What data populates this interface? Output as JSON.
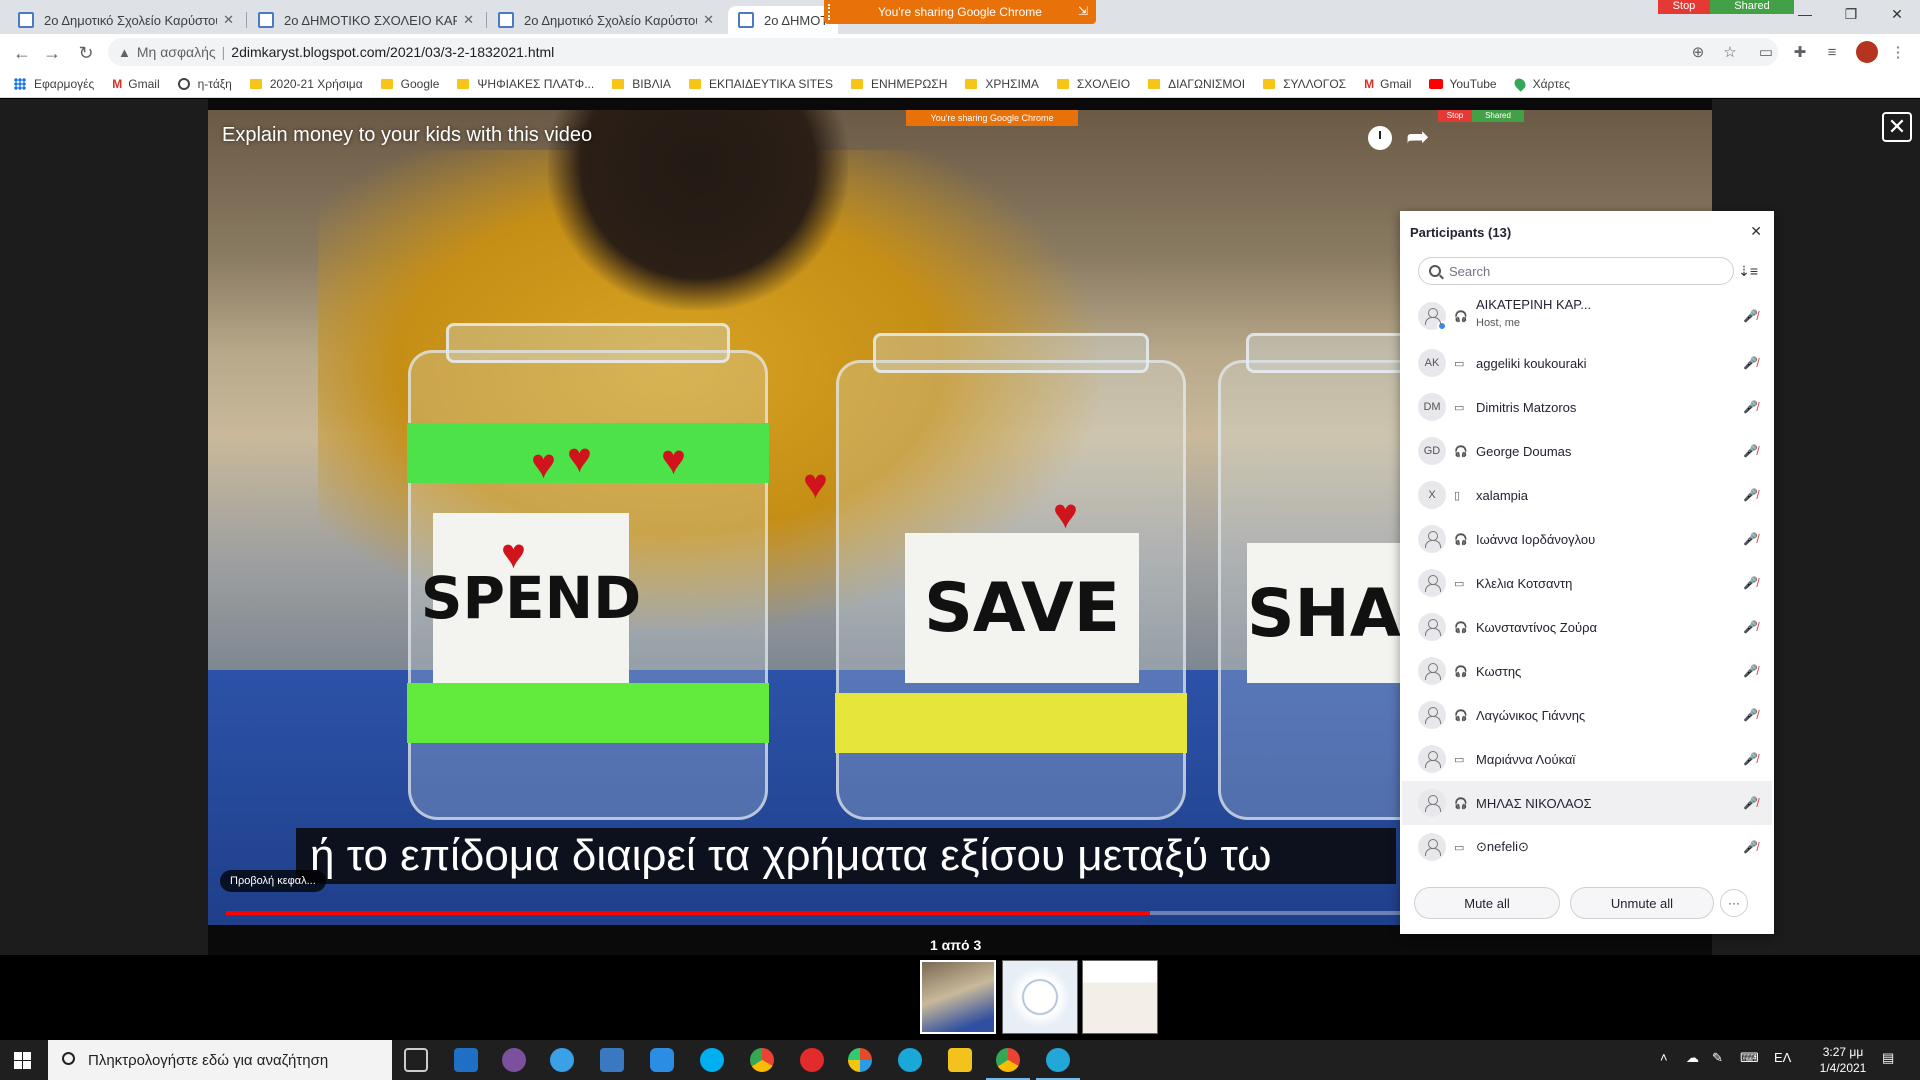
{
  "browser": {
    "tabs": [
      {
        "title": "2ο Δημοτικό Σχολείο Καρύστου"
      },
      {
        "title": "2ο ΔΗΜΟΤΙΚΟ ΣΧΟΛΕΙΟ ΚΑΡΥΣΤ"
      },
      {
        "title": "2ο Δημοτικό Σχολείο Καρύστου"
      },
      {
        "title": "2ο ΔΗΜΟΤΙ"
      }
    ],
    "sharing_banner": "You're sharing Google Chrome",
    "stop_label": "Stop",
    "shared_label": "Shared",
    "security_label": "Μη ασφαλής",
    "url": "2dimkaryst.blogspot.com/2021/03/3-2-1832021.html",
    "bookmarks": [
      {
        "label": "Εφαρμογές",
        "icon": "apps-grid-icon"
      },
      {
        "label": "Gmail",
        "icon": "gmail-icon"
      },
      {
        "label": "η-τάξη",
        "icon": "globe-icon"
      },
      {
        "label": "2020-21 Χρήσιμα",
        "icon": "folder-icon"
      },
      {
        "label": "Google",
        "icon": "folder-icon"
      },
      {
        "label": "ΨΗΦΙΑΚΕΣ ΠΛΑΤΦ...",
        "icon": "folder-icon"
      },
      {
        "label": "ΒΙΒΛΙΑ",
        "icon": "folder-icon"
      },
      {
        "label": "ΕΚΠΑΙΔΕΥΤΙΚΑ SITES",
        "icon": "folder-icon"
      },
      {
        "label": "ΕΝΗΜΕΡΩΣΗ",
        "icon": "folder-icon"
      },
      {
        "label": "ΧΡΗΣΙΜΑ",
        "icon": "folder-icon"
      },
      {
        "label": "ΣΧΟΛΕΙΟ",
        "icon": "folder-icon"
      },
      {
        "label": "ΔΙΑΓΩΝΙΣΜΟΙ",
        "icon": "folder-icon"
      },
      {
        "label": "ΣΥΛΛΟΓΟΣ",
        "icon": "folder-icon"
      },
      {
        "label": "Gmail",
        "icon": "gmail-icon"
      },
      {
        "label": "YouTube",
        "icon": "youtube-icon"
      },
      {
        "label": "Χάρτες",
        "icon": "maps-icon"
      }
    ]
  },
  "video": {
    "title": "Explain money to your kids with this video",
    "inner_sharing_banner": "You're sharing Google Chrome",
    "inner_stop": "Stop",
    "inner_shared": "Shared",
    "jar_labels": [
      "SPEND",
      "SAVE",
      "SHA"
    ],
    "caption": "ή το επίδομα διαιρεί τα χρήματα εξίσου μεταξύ τω",
    "chapter_label": "Προβολή κεφαλ...",
    "progress_fraction": 0.77
  },
  "participants": {
    "title": "Participants (13)",
    "search_placeholder": "Search",
    "list": [
      {
        "name": "ΑΙΚΑΤΕΡΙΝΗ ΚΑΡ...",
        "sub": "Host, me",
        "initials": "",
        "device": "headset"
      },
      {
        "name": "aggeliki koukouraki",
        "initials": "AK",
        "device": "screen"
      },
      {
        "name": "Dimitris Matzoros",
        "initials": "DM",
        "device": "screen"
      },
      {
        "name": "George Doumas",
        "initials": "GD",
        "device": "headset"
      },
      {
        "name": "xalampia",
        "initials": "X",
        "device": "phone"
      },
      {
        "name": "Ιωάννα Ιορδάνογλου",
        "initials": "",
        "device": "headset"
      },
      {
        "name": "Κλελια Κοτσαντη",
        "initials": "",
        "device": "screen"
      },
      {
        "name": "Κωνσταντίνος Ζούρα",
        "initials": "",
        "device": "headset"
      },
      {
        "name": "Κωστης",
        "initials": "",
        "device": "headset"
      },
      {
        "name": "Λαγώνικος Γιάννης",
        "initials": "",
        "device": "headset"
      },
      {
        "name": "Μαριάννα Λούκαϊ",
        "initials": "",
        "device": "screen"
      },
      {
        "name": "ΜΗΛΑΣ ΝΙΚΟΛΑΟΣ",
        "initials": "",
        "device": "headset"
      },
      {
        "name": "⊙nefeli⊙",
        "initials": "",
        "device": "screen"
      }
    ],
    "mute_all": "Mute all",
    "unmute_all": "Unmute all",
    "more": "···"
  },
  "viewer": {
    "page_count": "1 από 3"
  },
  "taskbar": {
    "search_placeholder": "Πληκτρολογήστε εδώ για αναζήτηση",
    "language": "ΕΛ",
    "time": "3:27 μμ",
    "date": "1/4/2021"
  }
}
